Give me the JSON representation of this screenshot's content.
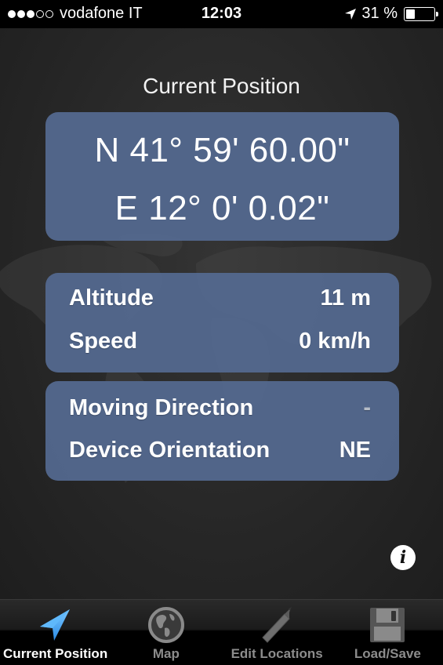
{
  "status_bar": {
    "signal_strength": 3,
    "signal_max": 5,
    "carrier": "vodafone IT",
    "time": "12:03",
    "location_icon": "location-arrow-icon",
    "battery_percent_label": "31 %",
    "battery_level": 0.31
  },
  "page": {
    "title": "Current Position"
  },
  "coordinates": {
    "latitude": "N 41° 59' 60.00\"",
    "longitude": "E 12° 0' 0.02\""
  },
  "motion": {
    "altitude_label": "Altitude",
    "altitude_value": "11 m",
    "speed_label": "Speed",
    "speed_value": "0 km/h"
  },
  "direction": {
    "moving_direction_label": "Moving Direction",
    "moving_direction_value": "-",
    "device_orientation_label": "Device Orientation",
    "device_orientation_value": "NE"
  },
  "info_button": {
    "glyph": "i"
  },
  "tab_bar": {
    "tabs": [
      {
        "label": "Current Position",
        "icon": "navigation-arrow-icon",
        "active": true
      },
      {
        "label": "Map",
        "icon": "globe-icon",
        "active": false
      },
      {
        "label": "Edit Locations",
        "icon": "pencil-icon",
        "active": false
      },
      {
        "label": "Load/Save",
        "icon": "floppy-disk-icon",
        "active": false
      }
    ]
  },
  "colors": {
    "card_background": "#53688e",
    "active_tab_icon": "#3fa6f2",
    "inactive_tab": "#8c8c8c"
  }
}
